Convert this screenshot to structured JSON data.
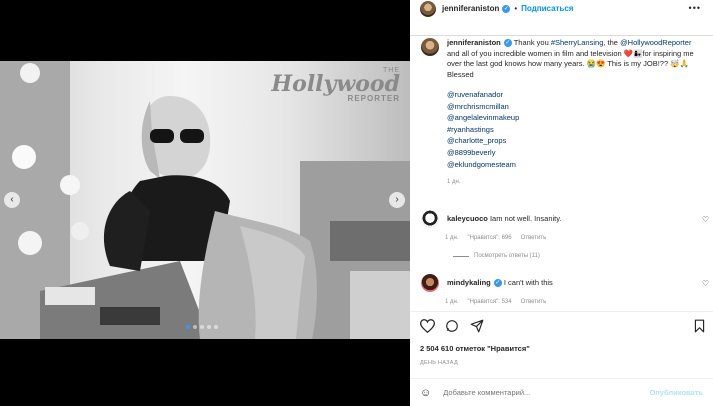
{
  "post": {
    "watermark": {
      "the": "THE",
      "brand": "Hollywood",
      "sub": "REPORTER"
    },
    "carousel": {
      "total": 5,
      "active_index": 0
    }
  },
  "header": {
    "username": "jenniferaniston",
    "separator": "•",
    "follow_label": "Подписаться",
    "more_label": "•••"
  },
  "caption": {
    "username": "jenniferaniston",
    "text_1": "Thank you ",
    "mention_1": "#SherryLansing",
    "text_2": ", the ",
    "mention_2": "@HollywoodReporter",
    "text_3": " and all of you incredible women in film and television ",
    "emoji_1": "❤️👩‍👧",
    "text_4": "for inspiring me over the last god knows how many years. ",
    "emoji_2": "😭😍",
    "text_5": " This is my JOB!?? ",
    "emoji_3": "🤯🙏",
    "text_6": " Blessed",
    "tags": [
      "@ruvenafanador",
      "@mrchrismcmillan",
      "@angelalevinmakeup",
      "#ryanhastings",
      "@charlotte_props",
      "@8899beverly",
      "@eklundgomesteam"
    ],
    "time": "1 дн."
  },
  "comments": [
    {
      "username": "kaleycuoco",
      "text": "Iam not well. Insanity.",
      "time": "1 дн.",
      "likes": "\"Нравится\": 696",
      "reply": "Ответить"
    },
    {
      "username": "mindykaling",
      "text": "I can't with this",
      "time": "1 дн.",
      "likes": "\"Нравится\": 534",
      "reply": "Ответить"
    }
  ],
  "view_replies": "Посмотреть ответы (11)",
  "likes_count": "2 504 610 отметок \"Нравится\"",
  "posted_when": "ДЕНЬ НАЗАД",
  "add_comment": {
    "placeholder": "Добавьте комментарий...",
    "publish_label": "Опубликовать"
  },
  "close_label": "✕"
}
